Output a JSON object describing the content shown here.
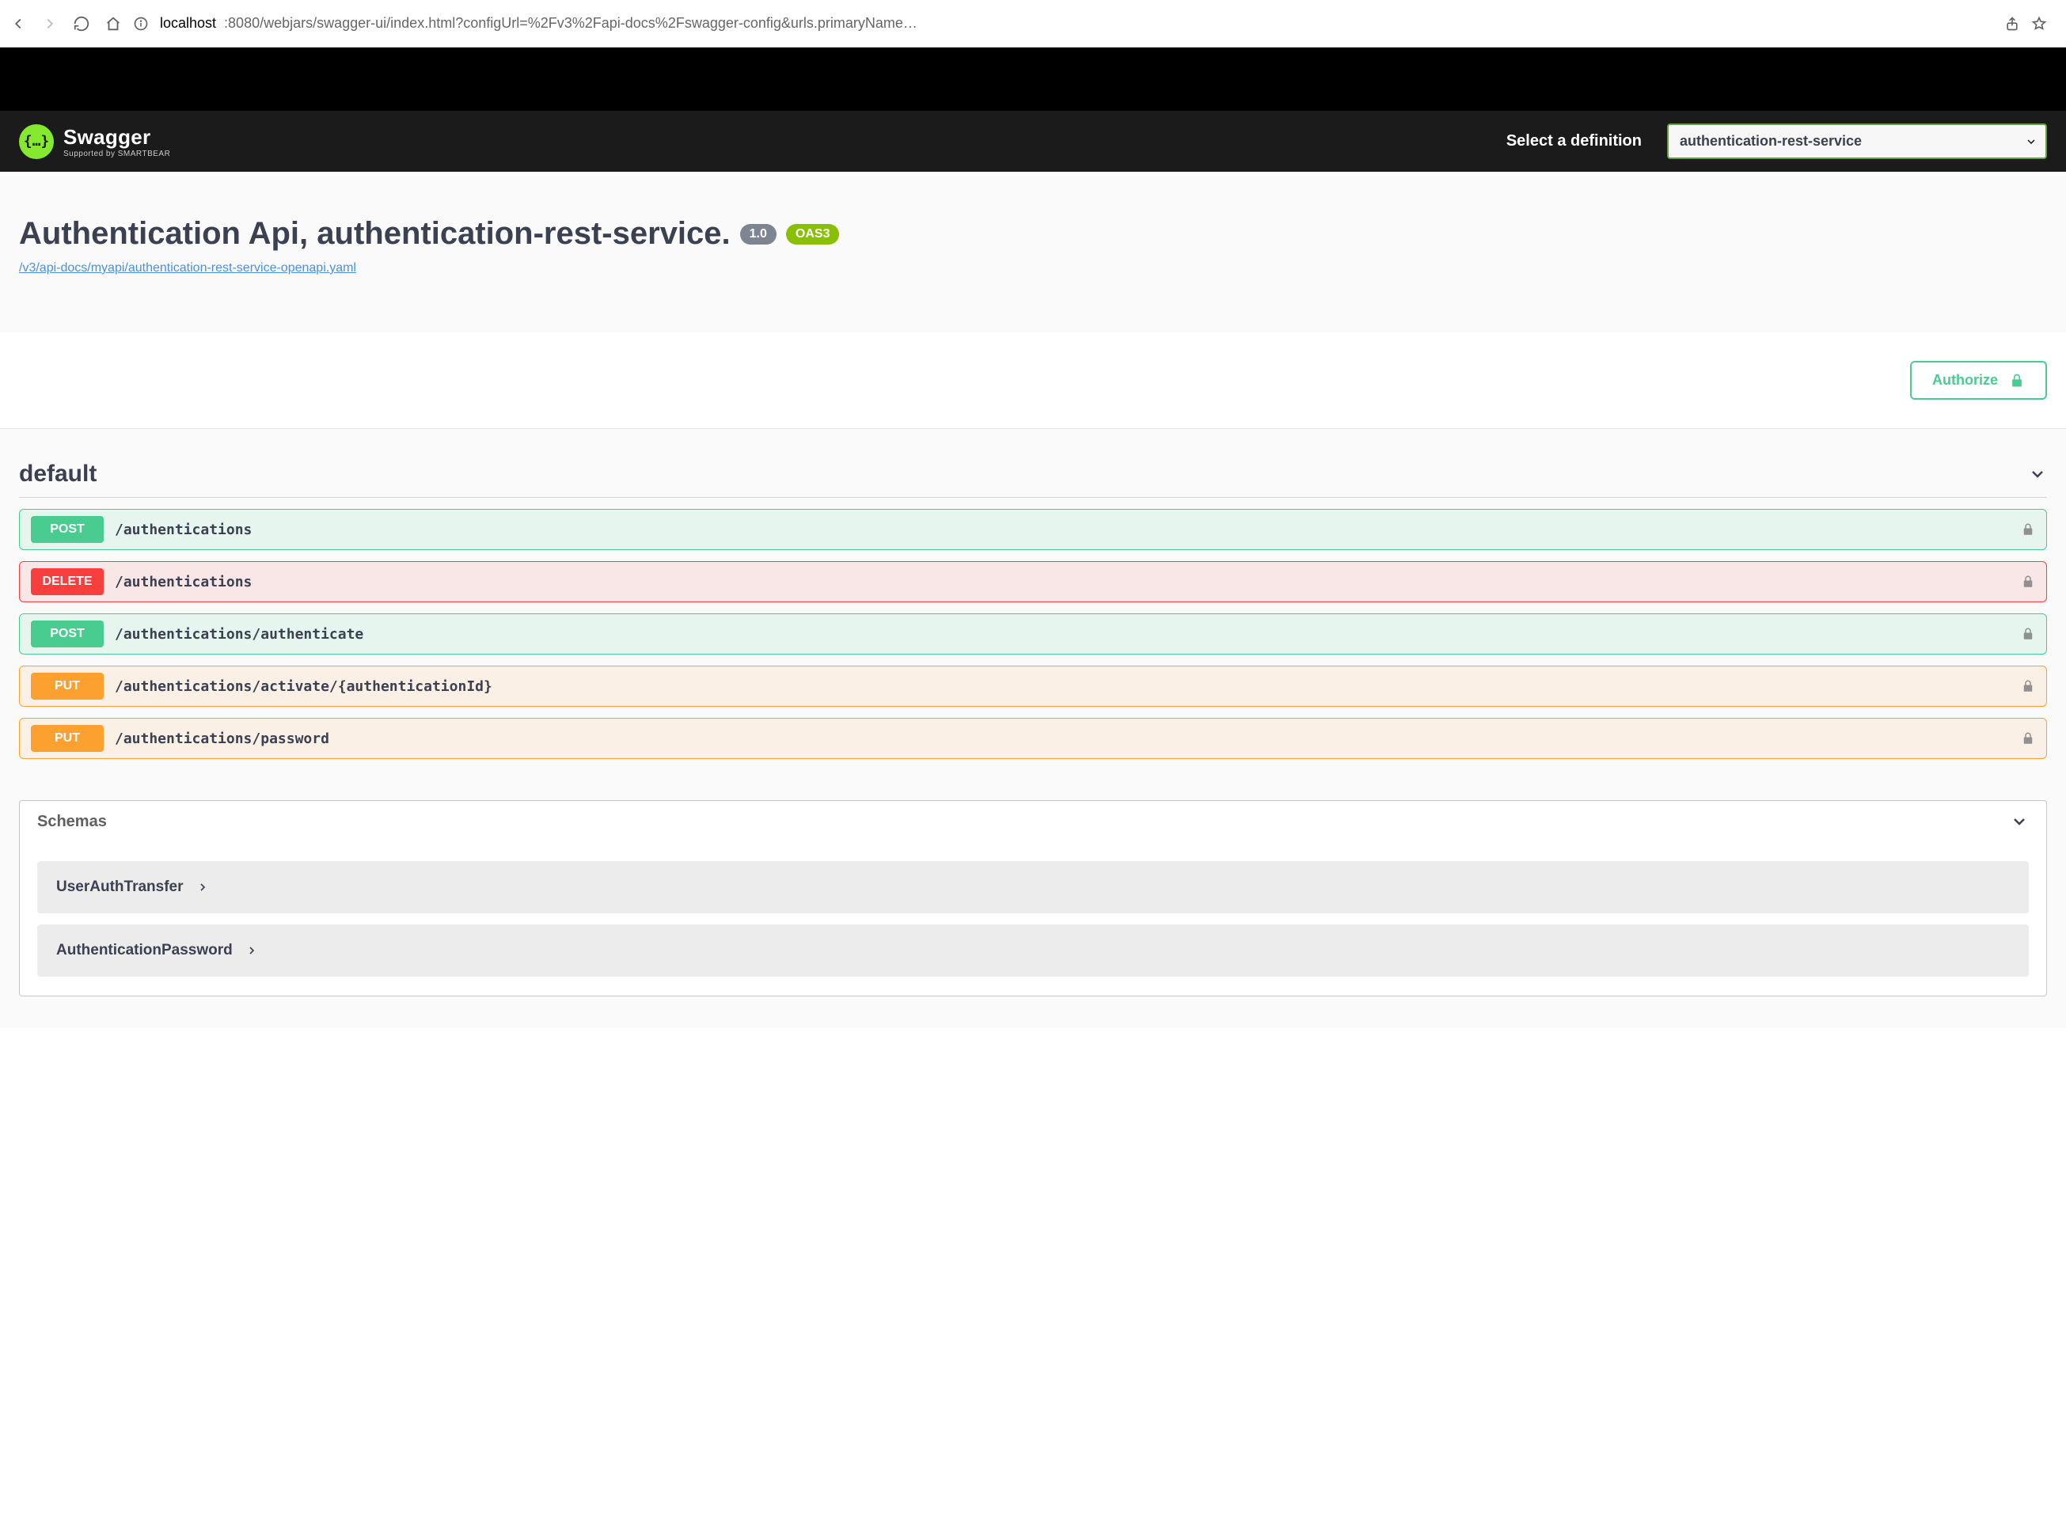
{
  "browser": {
    "host": "localhost",
    "path": ":8080/webjars/swagger-ui/index.html?configUrl=%2Fv3%2Fapi-docs%2Fswagger-config&urls.primaryName…"
  },
  "topbar": {
    "brand": "Swagger",
    "sub": "Supported by SMARTBEAR",
    "select_label": "Select a definition",
    "selected_definition": "authentication-rest-service"
  },
  "api": {
    "title": "Authentication Api, authentication-rest-service.",
    "version": "1.0",
    "oas_badge": "OAS3",
    "spec_url": "/v3/api-docs/myapi/authentication-rest-service-openapi.yaml"
  },
  "authorize_label": "Authorize",
  "tag": {
    "name": "default",
    "operations": [
      {
        "method": "POST",
        "css": "post",
        "path": "/authentications"
      },
      {
        "method": "DELETE",
        "css": "delete",
        "path": "/authentications"
      },
      {
        "method": "POST",
        "css": "post",
        "path": "/authentications/authenticate"
      },
      {
        "method": "PUT",
        "css": "put",
        "path": "/authentications/activate/{authenticationId}"
      },
      {
        "method": "PUT",
        "css": "put",
        "path": "/authentications/password"
      }
    ]
  },
  "schemas": {
    "title": "Schemas",
    "items": [
      {
        "name": "UserAuthTransfer"
      },
      {
        "name": "AuthenticationPassword"
      }
    ]
  },
  "colors": {
    "post": "#49cc90",
    "delete": "#f93e3e",
    "put": "#fca130",
    "accent_green": "#85ea2d",
    "link": "#4990e2"
  }
}
